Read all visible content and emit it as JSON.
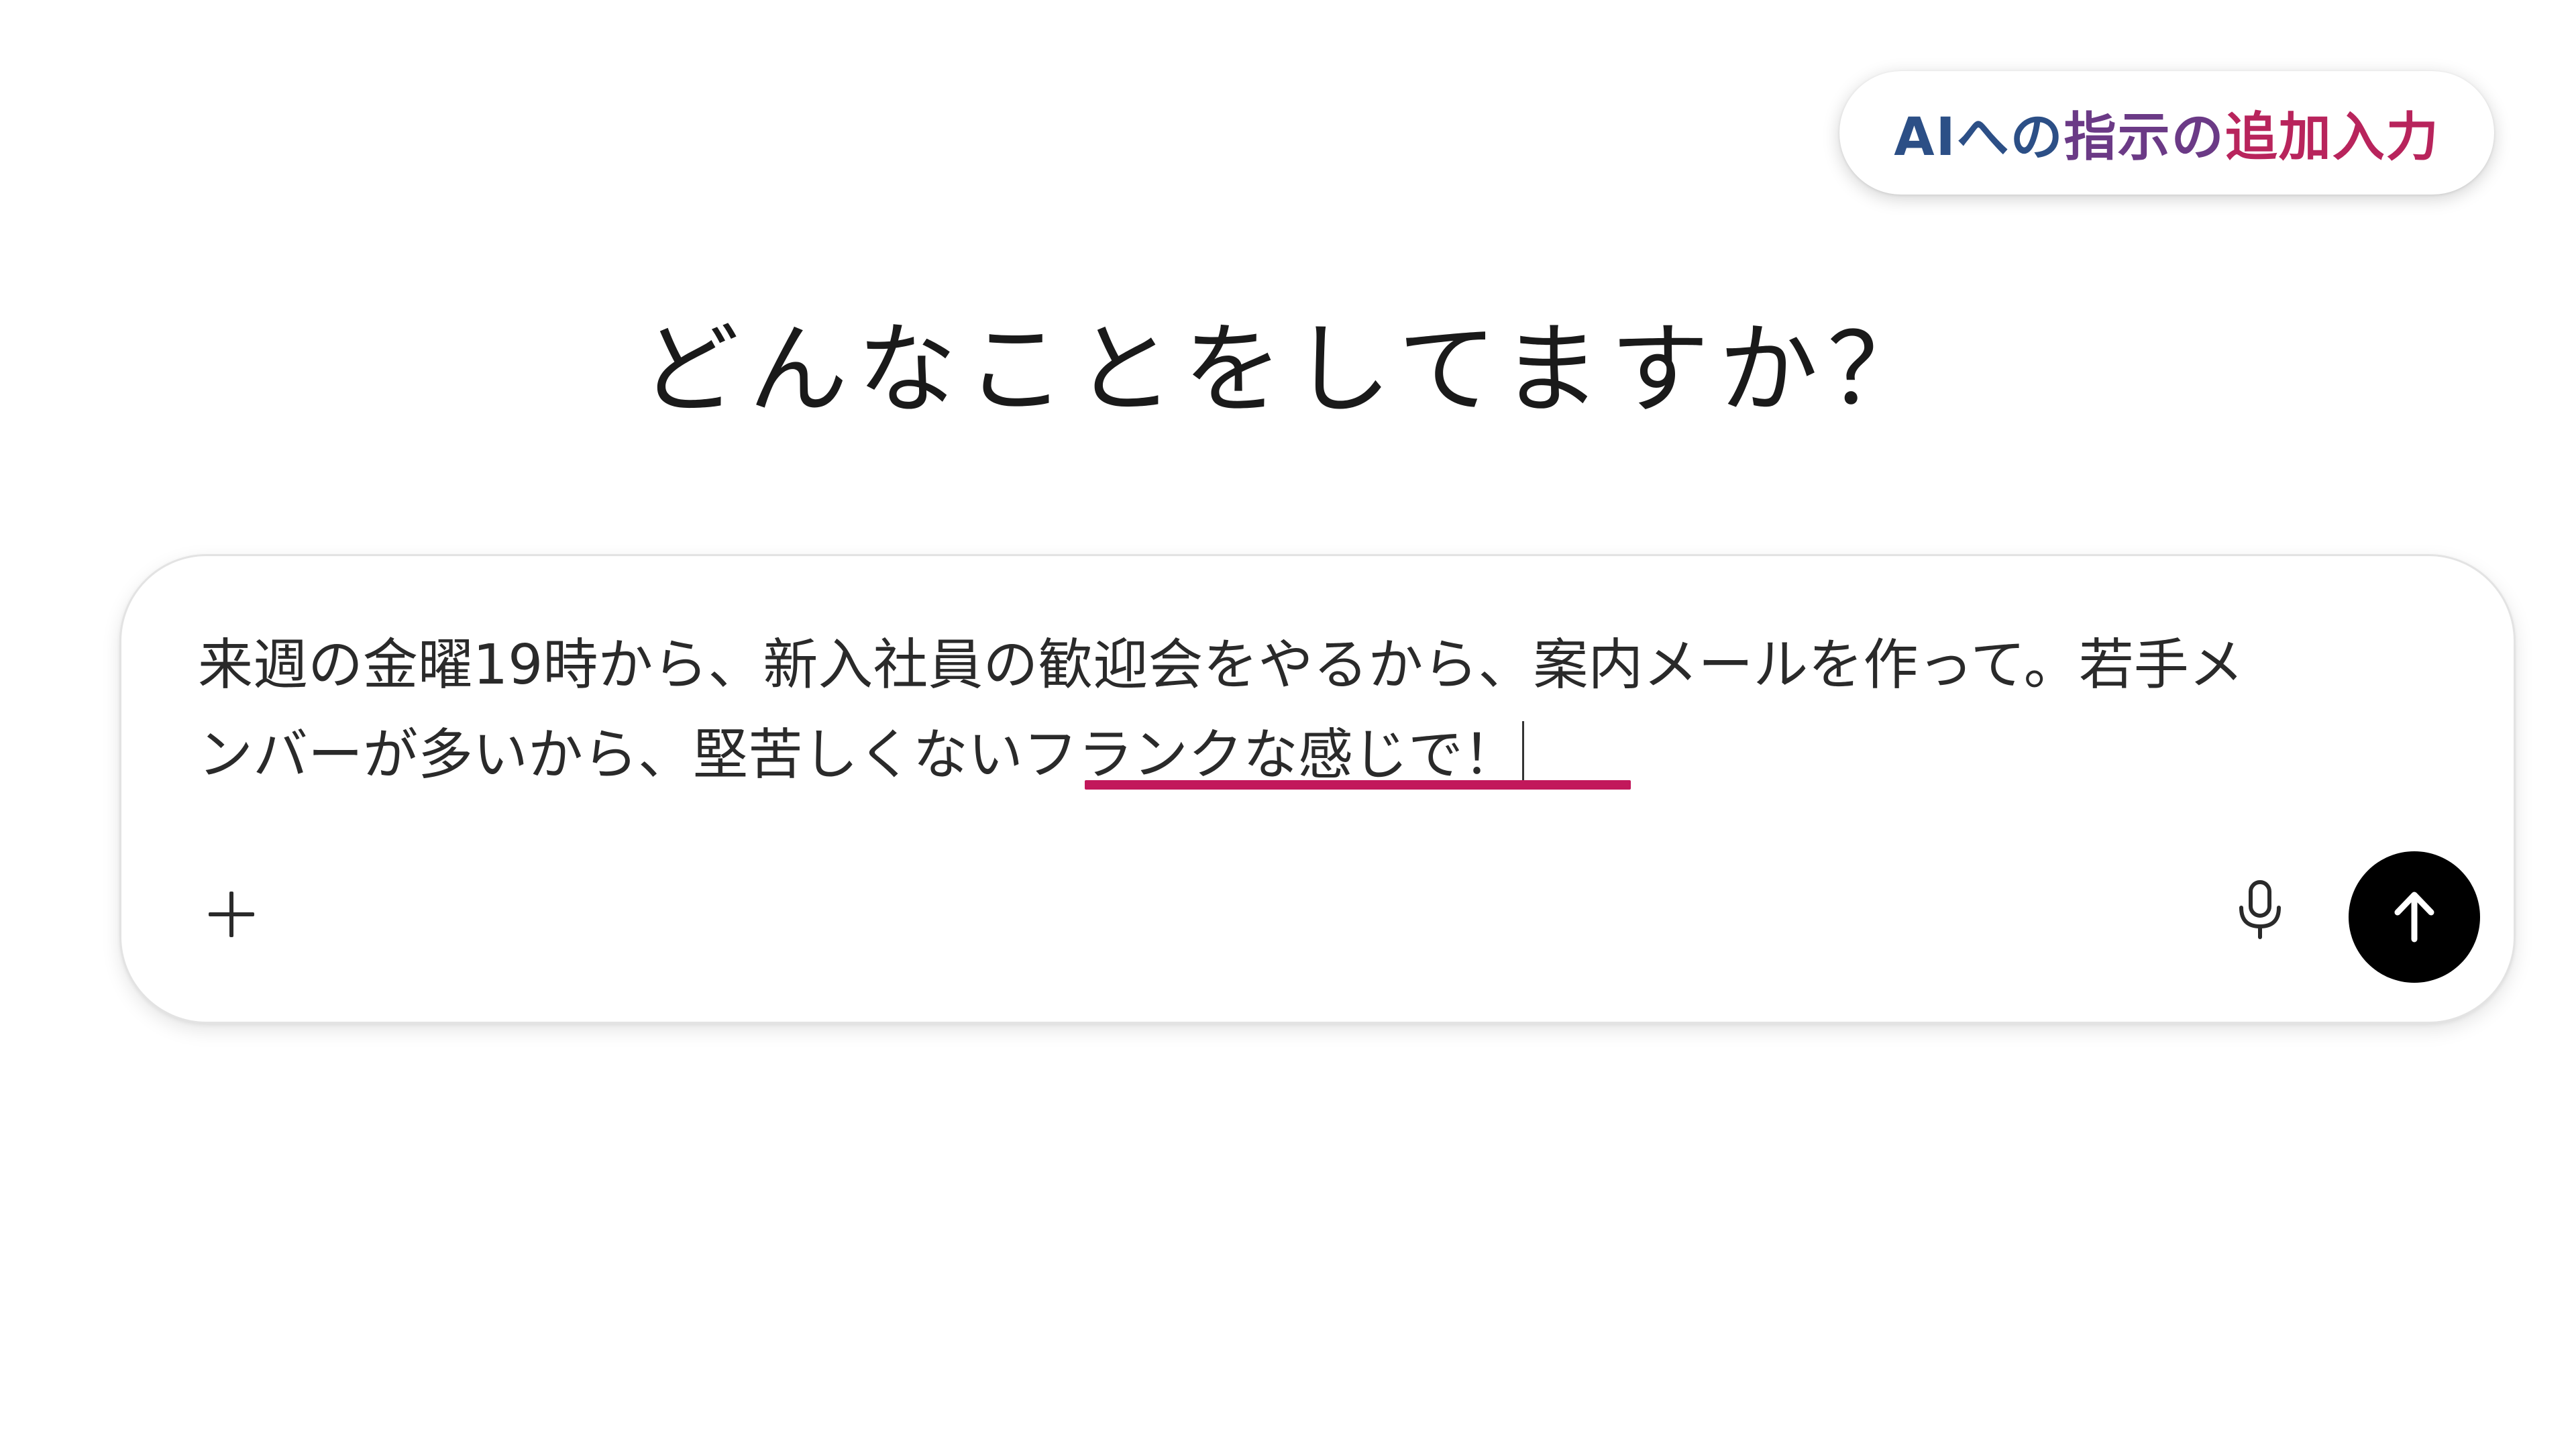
{
  "caption": {
    "part1": "AIへの",
    "part2": "指示の",
    "part3": "追加入力"
  },
  "heading": "どんなことをしてますか？",
  "composer": {
    "line1": "来週の金曜19時から、新入社員の歓迎会をやるから、案内メールを作って。若手メ",
    "line2_prefix": "ンバーが多いから、堅苦しくない",
    "line2_highlight": "フランクな感じで！",
    "highlight_color": "#c2185b",
    "plus_icon": "plus-icon",
    "mic_icon": "microphone-icon",
    "send_icon": "arrow-up-icon"
  }
}
